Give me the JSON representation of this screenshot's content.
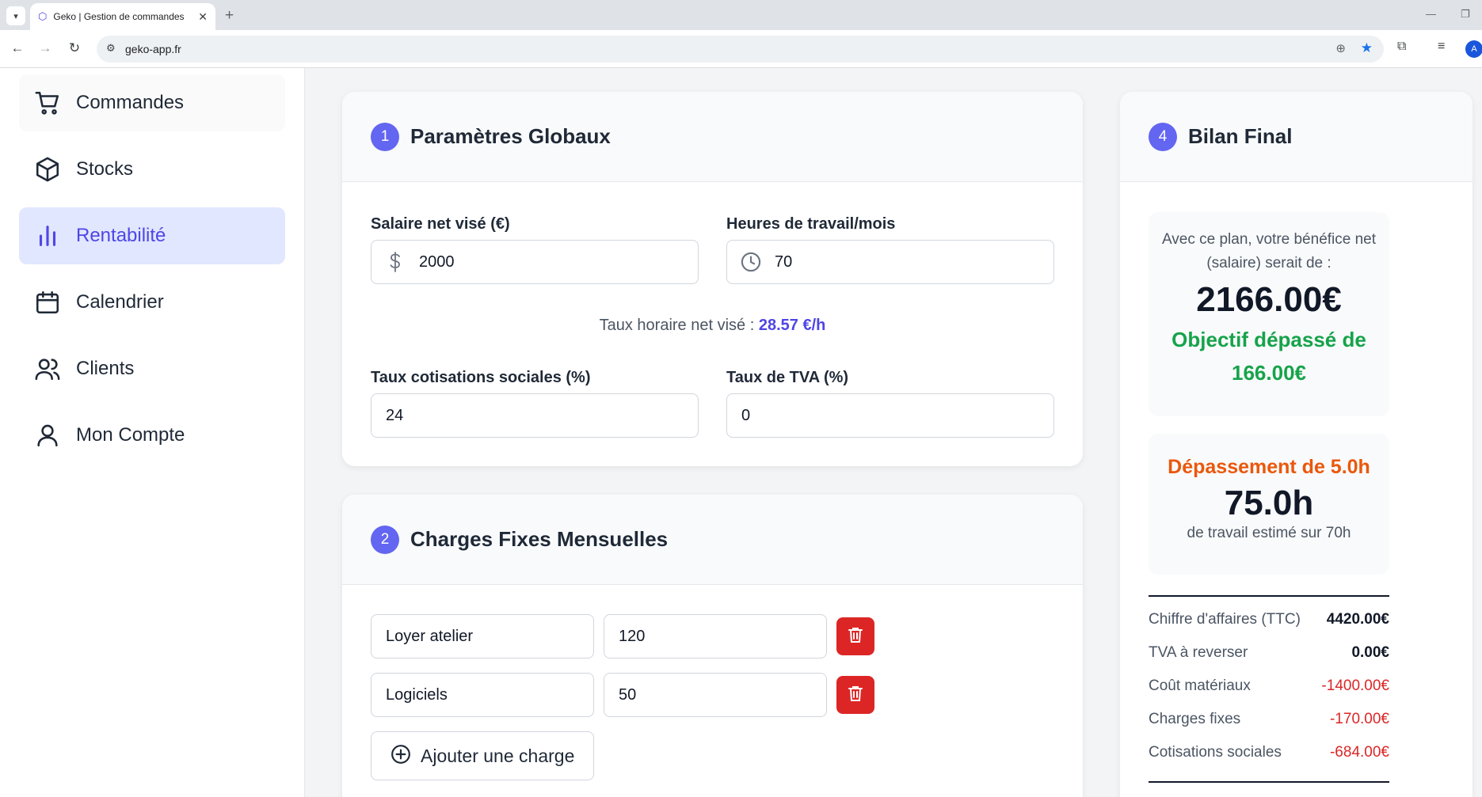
{
  "browser": {
    "tab_title": "Geko | Gestion de commandes",
    "url": "geko-app.fr",
    "profile_initial": "A"
  },
  "sidebar": {
    "items": [
      {
        "label": "Commandes",
        "icon": "cart-icon"
      },
      {
        "label": "Stocks",
        "icon": "box-icon"
      },
      {
        "label": "Rentabilité",
        "icon": "bar-chart-icon",
        "active": true
      },
      {
        "label": "Calendrier",
        "icon": "calendar-icon"
      },
      {
        "label": "Clients",
        "icon": "users-icon"
      },
      {
        "label": "Mon Compte",
        "icon": "user-icon"
      }
    ]
  },
  "params": {
    "step": "1",
    "title": "Paramètres Globaux",
    "salary_label": "Salaire net visé (€)",
    "salary_value": "2000",
    "hours_label": "Heures de travail/mois",
    "hours_value": "70",
    "rate_prefix": "Taux horaire net visé : ",
    "rate_value": "28.57 €/h",
    "social_label": "Taux cotisations sociales (%)",
    "social_value": "24",
    "tva_label": "Taux de TVA (%)",
    "tva_value": "0"
  },
  "charges": {
    "step": "2",
    "title": "Charges Fixes Mensuelles",
    "items": [
      {
        "name": "Loyer atelier",
        "amount": "120"
      },
      {
        "name": "Logiciels",
        "amount": "50"
      }
    ],
    "add_label": "Ajouter une charge"
  },
  "bilan": {
    "step": "4",
    "title": "Bilan Final",
    "intro": "Avec ce plan, votre bénéfice net (salaire) serait de :",
    "net_value": "2166.00€",
    "objective": "Objectif dépassé de 166.00€",
    "overtime": "Dépassement de 5.0h",
    "hours_total": "75.0h",
    "hours_sub": "de travail estimé sur 70h",
    "rows": [
      {
        "label": "Chiffre d'affaires (TTC)",
        "value": "4420.00€"
      },
      {
        "label": "TVA à reverser",
        "value": "0.00€"
      },
      {
        "label": "Coût matériaux",
        "value": "-1400.00€"
      },
      {
        "label": "Charges fixes",
        "value": "-170.00€"
      },
      {
        "label": "Cotisations sociales",
        "value": "-684.00€"
      }
    ]
  },
  "colors": {
    "accent": "#6366f1",
    "active_bg": "#e0e7ff",
    "danger": "#dc2626",
    "success": "#16a34a",
    "warning": "#ea580c"
  }
}
